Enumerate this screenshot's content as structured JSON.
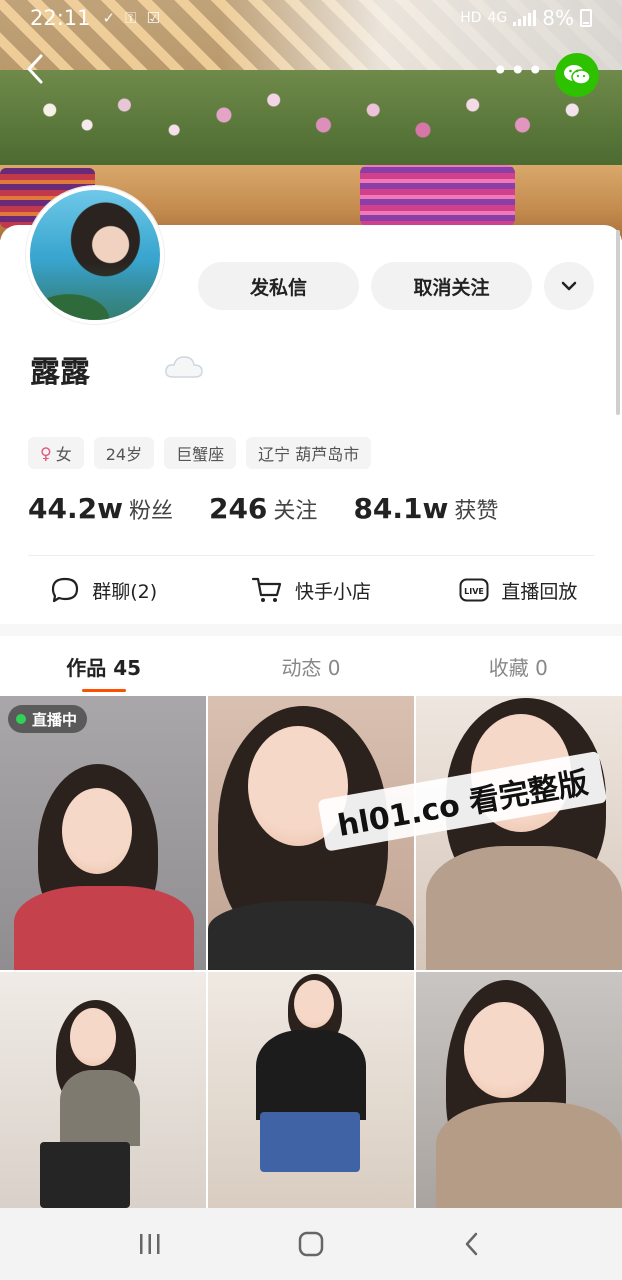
{
  "status_bar": {
    "time": "22:11",
    "network": "HD",
    "signal_type": "4G",
    "battery": "8%"
  },
  "profile": {
    "name": "露露",
    "actions": {
      "message": "发私信",
      "unfollow": "取消关注"
    },
    "tags": {
      "gender": "女",
      "age": "24岁",
      "zodiac": "巨蟹座",
      "location": "辽宁 葫芦岛市"
    },
    "stats": [
      {
        "value": "44.2w",
        "label": "粉丝"
      },
      {
        "value": "246",
        "label": "关注"
      },
      {
        "value": "84.1w",
        "label": "获赞"
      }
    ],
    "quick_links": [
      {
        "label": "群聊(2)",
        "icon": "chat-bubble-icon"
      },
      {
        "label": "快手小店",
        "icon": "shopping-cart-icon"
      },
      {
        "label": "直播回放",
        "icon": "live-icon"
      }
    ],
    "live_icon_text": "LIVE"
  },
  "tabs": [
    {
      "label": "作品 45",
      "active": true
    },
    {
      "label": "动态 0",
      "active": false
    },
    {
      "label": "收藏 0",
      "active": false
    }
  ],
  "grid": {
    "live_badge": "直播中",
    "watermark": "hl01.co 看完整版"
  },
  "colors": {
    "accent": "#ff5000",
    "wechat": "#2dc100",
    "live_dot": "#2fd158"
  }
}
